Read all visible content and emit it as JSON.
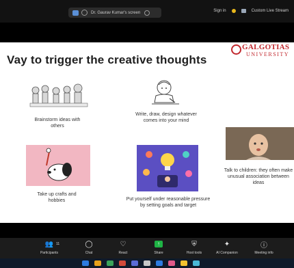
{
  "meeting": {
    "host_label": "Dr. Gaurav Kumar's screen",
    "sign_in": "Sign in",
    "custom_bg": "Custom Live Stream"
  },
  "slide": {
    "title": "Vay to trigger the creative thoughts",
    "logo_line1": "GALGOTIAS",
    "logo_line2": "UNIVERSITY",
    "items": [
      {
        "caption": "Brainstorm ideas with others"
      },
      {
        "caption": "Write, draw, design whatever comes into your mind"
      },
      {
        "caption": "Take up crafts and hobbies"
      },
      {
        "caption": "Put yourself under reasonable pressure by setting goals and target"
      },
      {
        "caption": "Talk to children: they often make unusual association between ideas"
      }
    ]
  },
  "toolbar": {
    "participants": "Participants",
    "participants_count": "11",
    "chat": "Chat",
    "react": "React",
    "share": "Share",
    "host_tools": "Host tools",
    "ai_companion": "AI Companion",
    "meeting_info": "Meeting info"
  },
  "colors": {
    "brand_red": "#c1272d",
    "share_green": "#1fb445"
  }
}
